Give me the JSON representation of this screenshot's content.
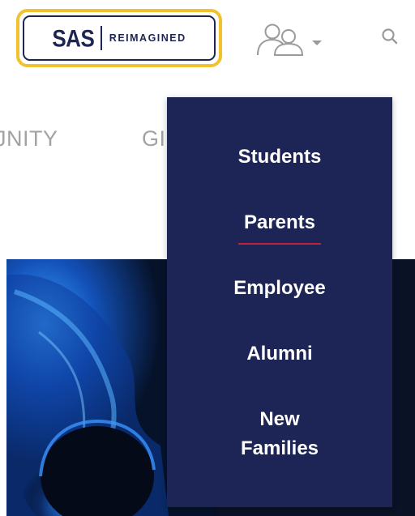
{
  "header": {
    "logo": {
      "primary": "SAS",
      "secondary": "REIMAGINED",
      "border_color": "#f2c22e",
      "text_color": "#1d2552"
    },
    "user_menu_icon": "users-icon",
    "dropdown_indicator_icon": "caret-down-icon",
    "search_icon": "search-icon"
  },
  "nav": {
    "items": [
      {
        "label": "COMMUNITY",
        "visible_text": "JNITY"
      },
      {
        "label": "GIVING",
        "visible_text": "GI"
      }
    ]
  },
  "dropdown": {
    "background": "#1d2557",
    "active_underline_color": "#c0223a",
    "active_item": "Parents",
    "items": [
      {
        "label": "Students"
      },
      {
        "label": "Parents"
      },
      {
        "label": "Employee"
      },
      {
        "label": "Alumni"
      },
      {
        "label": "New Families",
        "line1": "New",
        "line2": "Families"
      }
    ]
  },
  "hero": {
    "image": "blue-lit-abstract-image"
  }
}
